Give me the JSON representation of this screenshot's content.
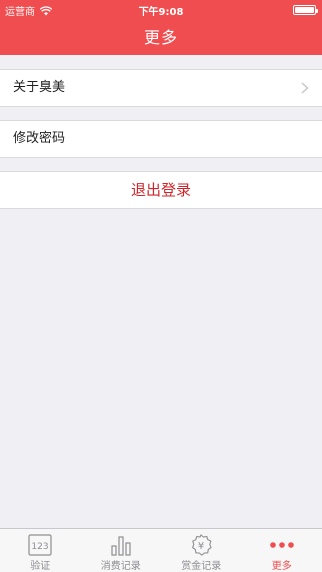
{
  "status_bar": {
    "carrier": "运营商",
    "time": "下午9:08"
  },
  "nav": {
    "title": "更多"
  },
  "menu": {
    "items": [
      {
        "label": "关于臭美",
        "has_chevron": true
      },
      {
        "label": "修改密码",
        "has_chevron": false
      }
    ],
    "logout_label": "退出登录"
  },
  "tabbar": {
    "tabs": [
      {
        "label": "验证",
        "icon": "keypad-123-icon",
        "icon_text": "123",
        "active": false
      },
      {
        "label": "消费记录",
        "icon": "bar-chart-icon",
        "active": false
      },
      {
        "label": "赏金记录",
        "icon": "yen-badge-icon",
        "icon_text": "¥",
        "active": false
      },
      {
        "label": "更多",
        "icon": "more-dots-icon",
        "active": true
      }
    ]
  },
  "colors": {
    "header": "#ef4d4f",
    "logout_text": "#d0262b",
    "tab_active": "#ef4d4f",
    "tab_inactive": "#8e8e93",
    "background": "#efeff4"
  }
}
